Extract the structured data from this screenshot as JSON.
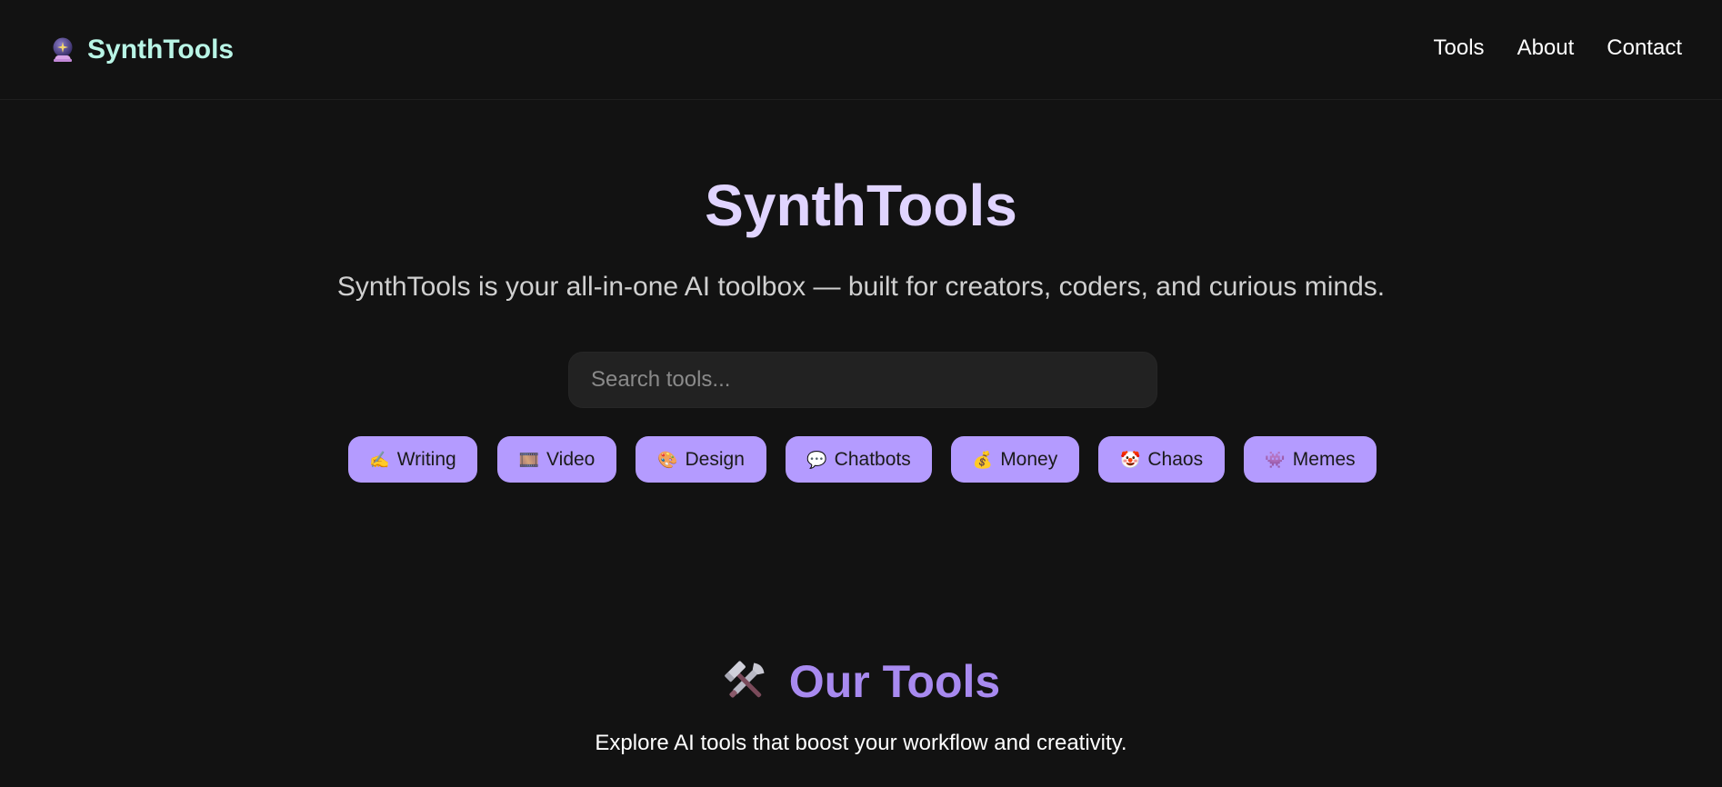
{
  "header": {
    "brand": "SynthTools",
    "brand_icon": "crystal-ball-icon",
    "nav": [
      {
        "label": "Tools"
      },
      {
        "label": "About"
      },
      {
        "label": "Contact"
      }
    ]
  },
  "hero": {
    "title": "SynthTools",
    "subtitle": "SynthTools is your all-in-one AI toolbox — built for creators, coders, and curious minds.",
    "search_placeholder": "Search tools..."
  },
  "categories": [
    {
      "emoji": "✍️",
      "label": "Writing",
      "icon": "writing-hand-icon"
    },
    {
      "emoji": "🎞️",
      "label": "Video",
      "icon": "film-frames-icon"
    },
    {
      "emoji": "🎨",
      "label": "Design",
      "icon": "palette-icon"
    },
    {
      "emoji": "💬",
      "label": "Chatbots",
      "icon": "speech-bubble-icon"
    },
    {
      "emoji": "💰",
      "label": "Money",
      "icon": "money-bag-icon"
    },
    {
      "emoji": "🤡",
      "label": "Chaos",
      "icon": "clown-face-icon"
    },
    {
      "emoji": "👾",
      "label": "Memes",
      "icon": "alien-monster-icon"
    }
  ],
  "tools_section": {
    "icon": "hammer-and-wrench-icon",
    "title": "Our Tools",
    "subtitle": "Explore AI tools that boost your workflow and creativity."
  },
  "colors": {
    "background": "#121212",
    "brand": "#b9f5e6",
    "hero_title": "#e0d4ff",
    "chip_bg": "#b49bff",
    "section_title": "#a88af0"
  }
}
